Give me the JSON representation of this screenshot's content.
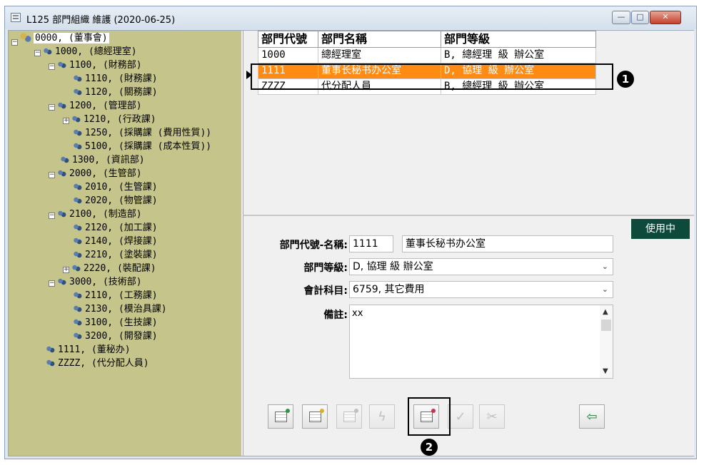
{
  "window": {
    "title": "L125 部門組織 維護 (2020-06-25)",
    "controls": {
      "minimize": "—",
      "maximize": "□",
      "close": "✕"
    }
  },
  "tree": {
    "nodes": [
      {
        "label": "0000, (董事會)",
        "expander": "−"
      },
      {
        "label": "1000, (總經理室)",
        "expander": "−"
      },
      {
        "label": "1100, (財務部)",
        "expander": "−"
      },
      {
        "label": "1110, (財務課)",
        "expander": ""
      },
      {
        "label": "1120, (關務課)",
        "expander": ""
      },
      {
        "label": "1200, (管理部)",
        "expander": "−"
      },
      {
        "label": "1210, (行政課)",
        "expander": "+"
      },
      {
        "label": "1250, (採購課 (費用性質))",
        "expander": ""
      },
      {
        "label": "5100, (採購課 (成本性質))",
        "expander": ""
      },
      {
        "label": "1300, (資訊部)",
        "expander": ""
      },
      {
        "label": "2000, (生管部)",
        "expander": "−"
      },
      {
        "label": "2010, (生管課)",
        "expander": ""
      },
      {
        "label": "2020, (物管課)",
        "expander": ""
      },
      {
        "label": "2100, (制造部)",
        "expander": "−"
      },
      {
        "label": "2120, (加工課)",
        "expander": ""
      },
      {
        "label": "2140, (焊接課)",
        "expander": ""
      },
      {
        "label": "2210, (塗裝課)",
        "expander": ""
      },
      {
        "label": "2220, (裝配課)",
        "expander": "+"
      },
      {
        "label": "3000, (技術部)",
        "expander": "−"
      },
      {
        "label": "2110, (工務課)",
        "expander": ""
      },
      {
        "label": "2130, (模治具課)",
        "expander": ""
      },
      {
        "label": "3100, (生技課)",
        "expander": ""
      },
      {
        "label": "3200, (開發課)",
        "expander": ""
      },
      {
        "label": "1111, (董秘办)",
        "expander": ""
      },
      {
        "label": "ZZZZ, (代分配人員)",
        "expander": ""
      }
    ]
  },
  "grid": {
    "columns": [
      "部門代號",
      "部門名稱",
      "部門等級"
    ],
    "rows": [
      [
        "1000",
        "總經理室",
        "B, 總經理 級 辦公室"
      ],
      [
        "1111",
        "董事长秘书办公室",
        "D, 協理 級 辦公室"
      ],
      [
        "ZZZZ",
        "代分配人員",
        "B, 總經理 級 辦公室"
      ]
    ],
    "pointer": "▶"
  },
  "callouts": {
    "first": "1",
    "second": "2"
  },
  "form": {
    "status": "使用中",
    "code_name_label": "部門代號-名稱:",
    "code_value": "1111",
    "name_value": "董事长秘书办公室",
    "level_label": "部門等級:",
    "level_value": "D, 協理 級 辦公室",
    "account_label": "會計科目:",
    "account_value": "6759, 其它費用",
    "memo_label": "備註:",
    "memo_value": "xx",
    "chevron": "⌄"
  },
  "toolbar": {
    "edit_glyph": "✓",
    "cancel_glyph": "✂",
    "flash_glyph": "ϟ",
    "exit_glyph": "⇦"
  },
  "colors": {
    "tree_bg": "#c5c48b",
    "selection": "#ff8a14",
    "status_bg": "#0d4a3c"
  }
}
